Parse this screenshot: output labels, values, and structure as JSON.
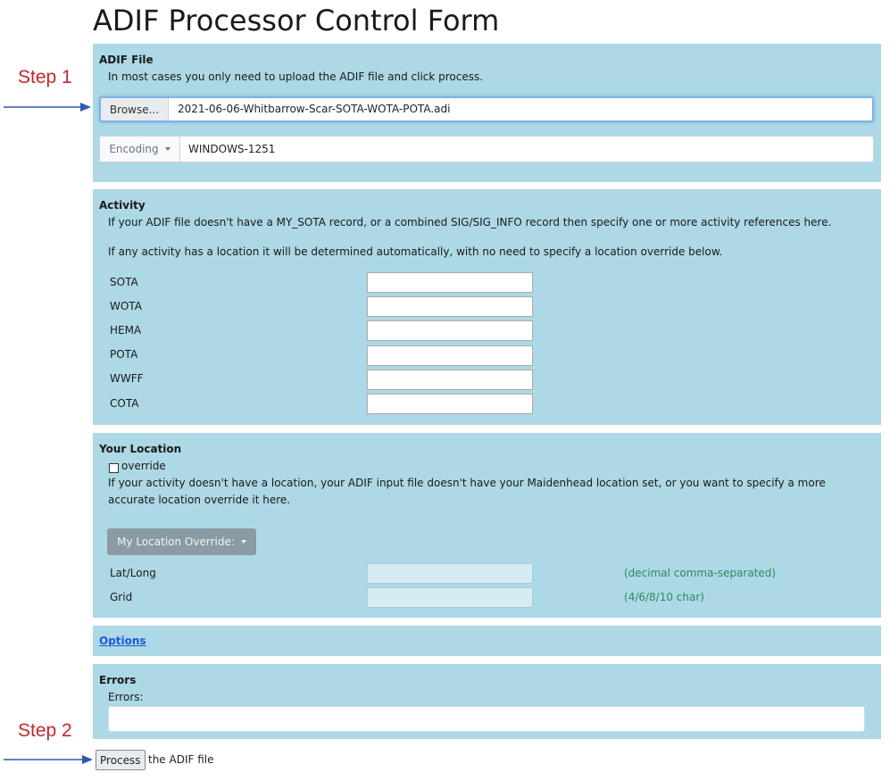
{
  "page": {
    "title": "ADIF Processor Control Form"
  },
  "annotations": {
    "step1": "Step 1",
    "step2": "Step 2",
    "arrow_color": "#2f5aa8",
    "step_color": "#c0282b"
  },
  "adif_file": {
    "heading": "ADIF File",
    "description": "In most cases you only need to upload the ADIF file and click process.",
    "browse_label": "Browse...",
    "file_name": "2021-06-06-Whitbarrow-Scar-SOTA-WOTA-POTA.adi",
    "encoding_label": "Encoding",
    "encoding_value": "WINDOWS-1251"
  },
  "activity": {
    "heading": "Activity",
    "line1": "If your ADIF file doesn't have a MY_SOTA record, or a combined SIG/SIG_INFO record then specify one or more activity references here.",
    "line2": "If any activity has a location it will be determined automatically, with no need to specify a location override below.",
    "fields": [
      {
        "label": "SOTA",
        "value": ""
      },
      {
        "label": "WOTA",
        "value": ""
      },
      {
        "label": "HEMA",
        "value": ""
      },
      {
        "label": "POTA",
        "value": ""
      },
      {
        "label": "WWFF",
        "value": ""
      },
      {
        "label": "COTA",
        "value": ""
      }
    ]
  },
  "location": {
    "heading": "Your Location",
    "override_label": "override",
    "override_checked": false,
    "description_line1": "If your activity doesn't have a location, your ADIF input file doesn't have your Maidenhead location set, or you want to specify a more",
    "description_line2": "accurate location override it here.",
    "dropdown_label": "My Location Override:",
    "latlong_label": "Lat/Long",
    "latlong_value": "",
    "latlong_hint": "(decimal comma-separated)",
    "grid_label": "Grid",
    "grid_value": "",
    "grid_hint": "(4/6/8/10 char)"
  },
  "options": {
    "link_label": "Options"
  },
  "errors": {
    "heading": "Errors",
    "label": "Errors:",
    "value": ""
  },
  "process": {
    "button_label": "Process",
    "suffix_text": "the ADIF file"
  },
  "colors": {
    "panel_bg": "#add8e6",
    "hint_green": "#2c8a5a",
    "link_blue": "#1a5bd6"
  }
}
